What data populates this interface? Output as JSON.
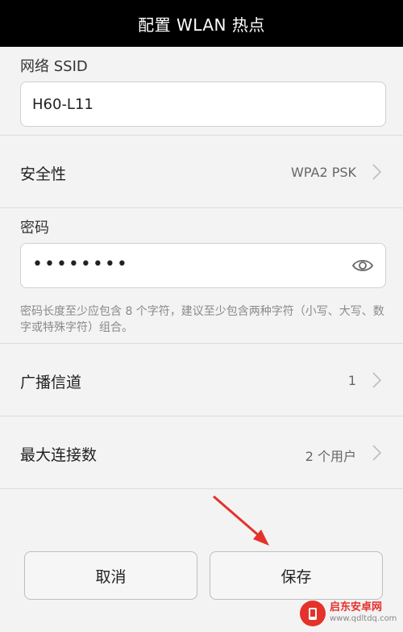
{
  "header": {
    "title": "配置 WLAN 热点"
  },
  "ssid": {
    "label": "网络 SSID",
    "value": "H60-L11"
  },
  "security": {
    "label": "安全性",
    "value": "WPA2 PSK"
  },
  "password": {
    "label": "密码",
    "value": "••••••••",
    "hint": "密码长度至少应包含 8 个字符，建议至少包含两种字符（小写、大写、数字或特殊字符）组合。"
  },
  "channel": {
    "label": "广播信道",
    "value": "1"
  },
  "max_connections": {
    "label": "最大连接数",
    "value": "2 个用户"
  },
  "buttons": {
    "cancel": "取消",
    "save": "保存"
  },
  "watermark": {
    "name": "启东安卓网",
    "url": "www.qdltdq.com"
  },
  "colors": {
    "accent_red": "#e4322b",
    "titlebar_bg": "#000000"
  }
}
